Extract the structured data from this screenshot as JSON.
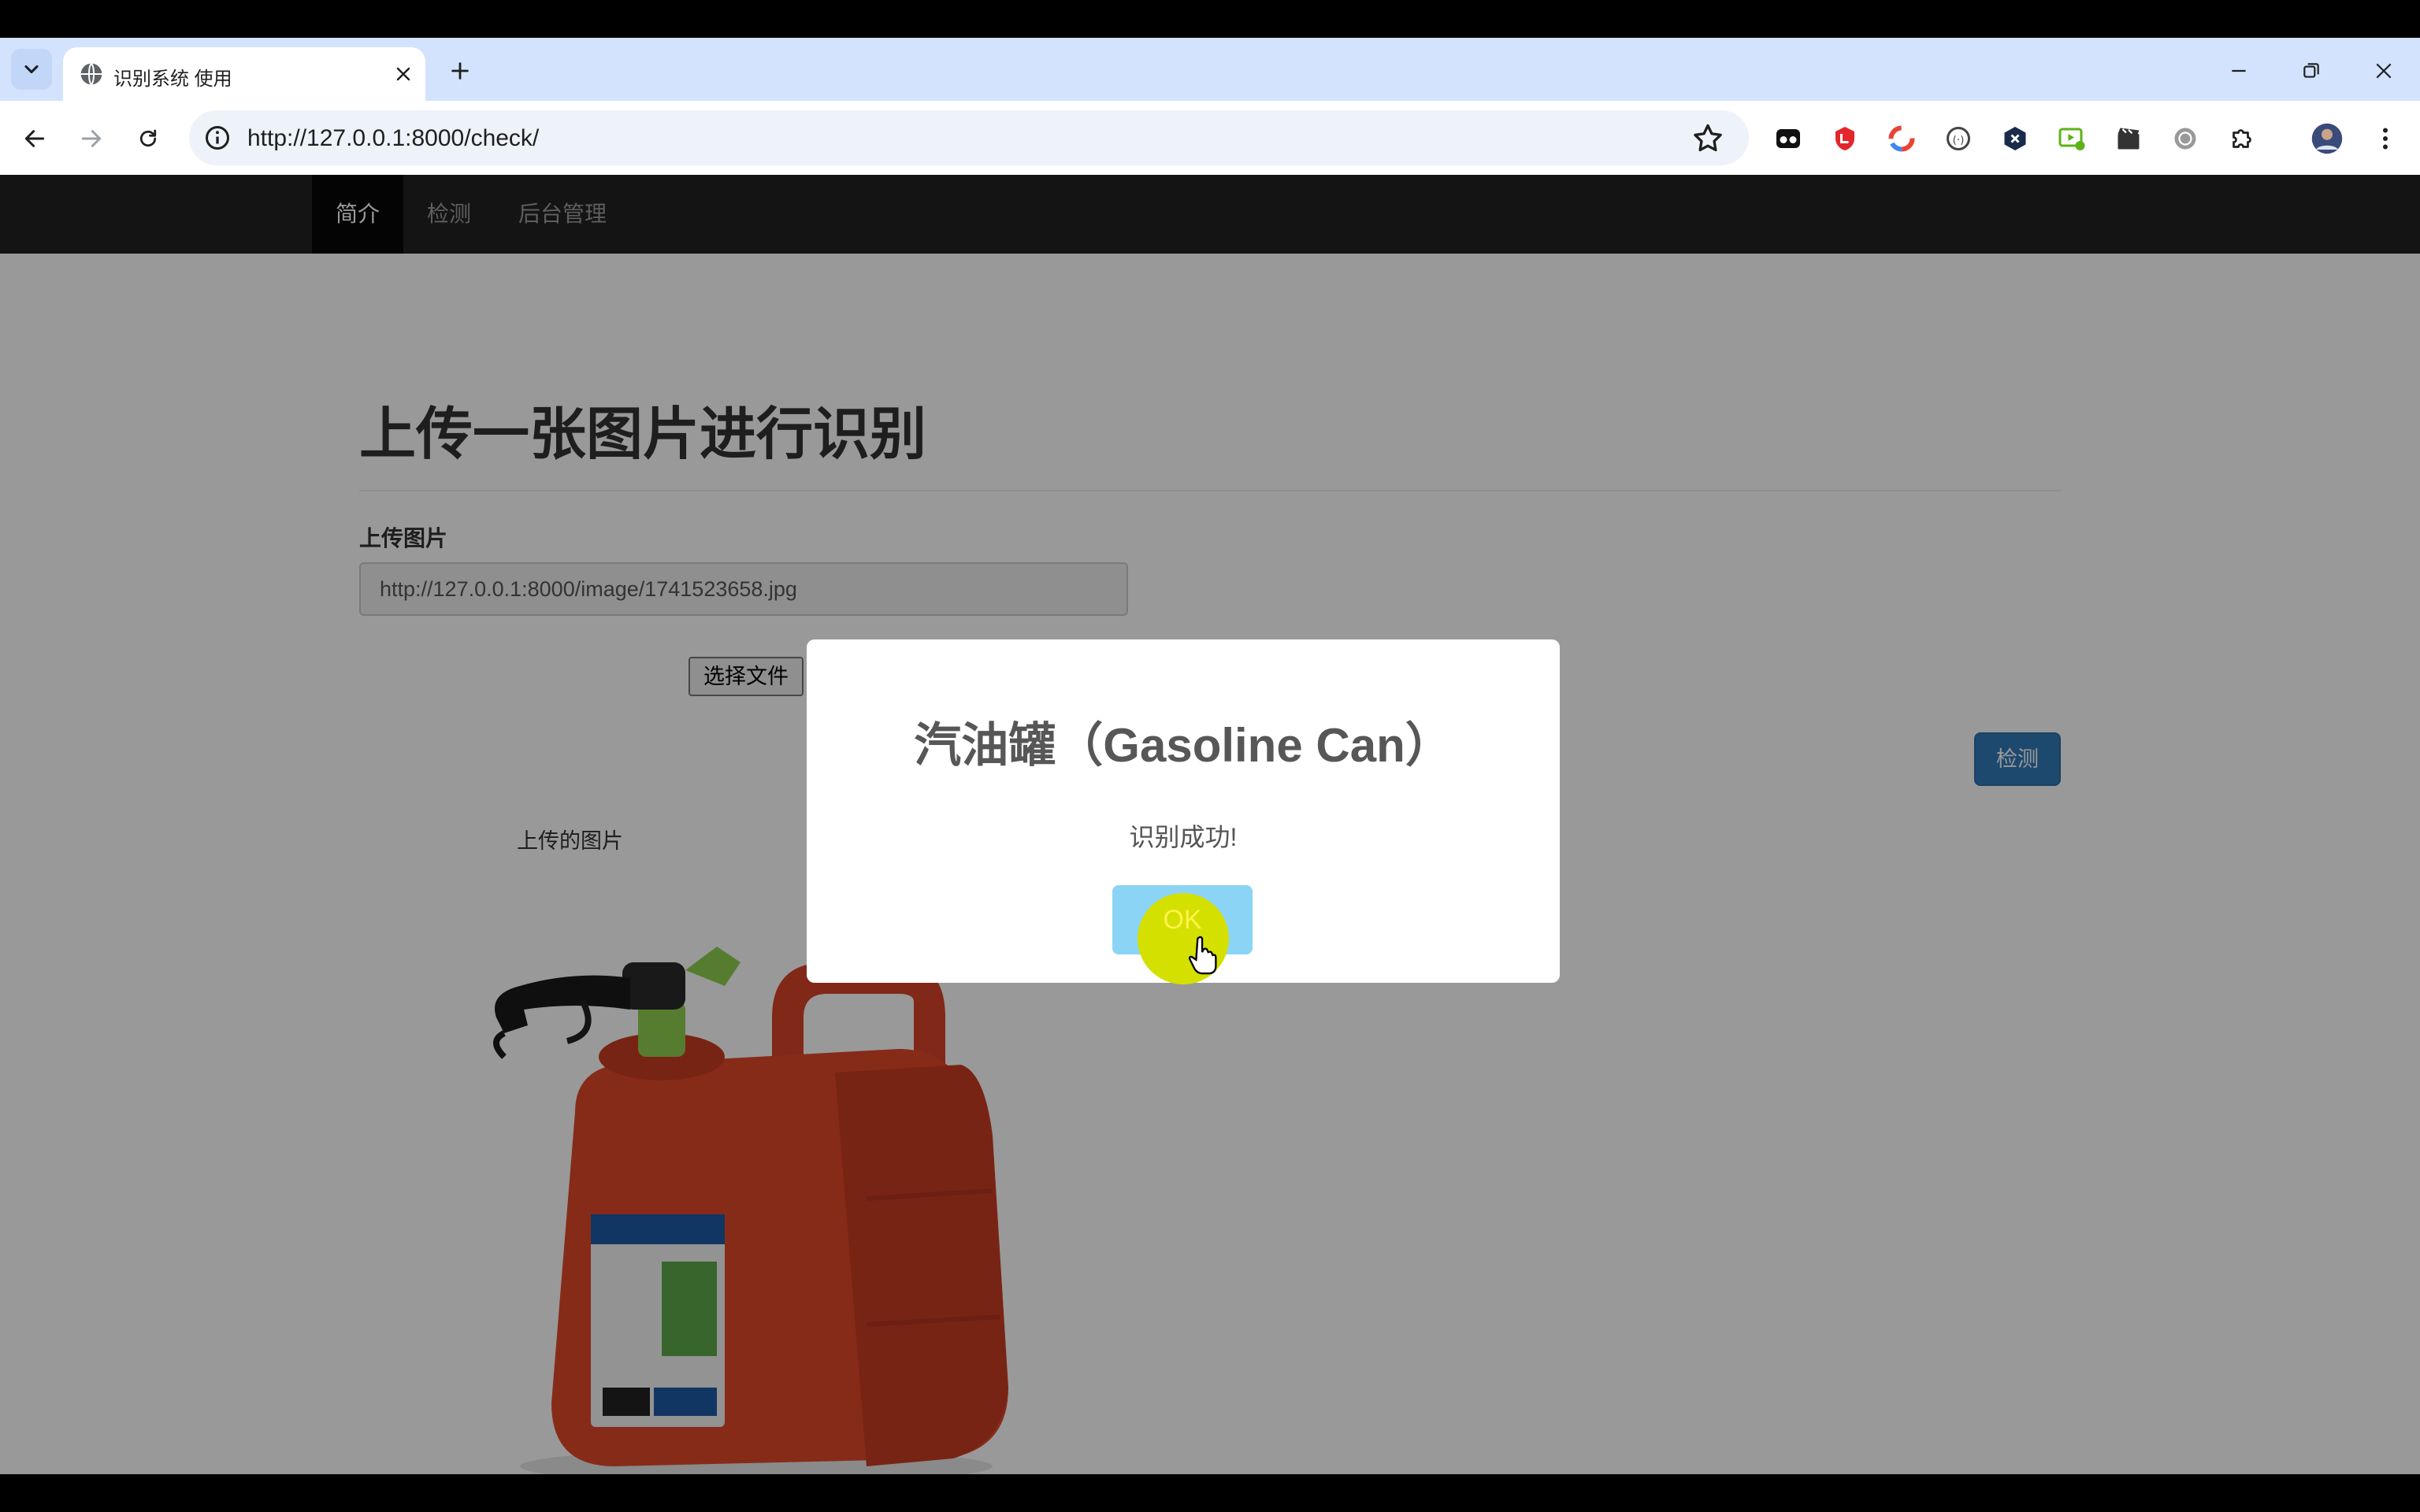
{
  "browser": {
    "tab_title": "识别系统 使用",
    "url": "http://127.0.0.1:8000/check/"
  },
  "navbar": {
    "items": [
      {
        "label": "简介",
        "active": true
      },
      {
        "label": "检测",
        "active": false
      },
      {
        "label": "后台管理",
        "active": false
      }
    ]
  },
  "main": {
    "title": "上传一张图片进行识别",
    "upload_label": "上传图片",
    "image_url_value": "http://127.0.0.1:8000/image/1741523658.jpg",
    "choose_file_label": "选择文件",
    "detect_button_label": "检测",
    "uploaded_image_caption": "上传的图片"
  },
  "modal": {
    "title": "汽油罐（Gasoline Can）",
    "message": "识别成功!",
    "ok_label": "OK"
  },
  "colors": {
    "navbar_bg": "#222222",
    "primary_button": "#337ab7",
    "ok_button": "#8cd4f5",
    "click_highlight": "#d4e000",
    "gascan_red": "#e2492b",
    "nozzle_green": "#8fd14f"
  }
}
